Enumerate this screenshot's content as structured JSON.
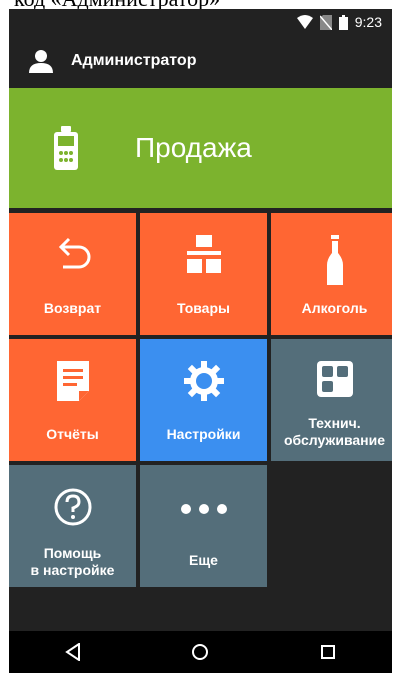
{
  "caption": "код «Администратор»",
  "status": {
    "time": "9:23",
    "icons": [
      "wifi-icon",
      "no-sim-icon",
      "battery-icon"
    ]
  },
  "user": {
    "name": "Администратор",
    "icon": "person-icon"
  },
  "sale": {
    "label": "Продажа",
    "icon": "pos-terminal-icon",
    "color": "#7cb32e"
  },
  "tiles": [
    {
      "label": "Возврат",
      "icon": "undo-arrow-icon",
      "color": "#ff6633"
    },
    {
      "label": "Товары",
      "icon": "boxes-icon",
      "color": "#ff6633"
    },
    {
      "label": "Алкоголь",
      "icon": "bottle-icon",
      "color": "#ff6633"
    },
    {
      "label": "Отчёты",
      "icon": "document-icon",
      "color": "#ff6633"
    },
    {
      "label": "Настройки",
      "icon": "gear-icon",
      "color": "#3b8ff0"
    },
    {
      "label": "Технич.\nобслуживание",
      "icon": "dashboard-icon",
      "color": "#546e7a"
    },
    {
      "label": "Помощь\nв настройке",
      "icon": "help-circle-icon",
      "color": "#546e7a"
    },
    {
      "label": "Еще",
      "icon": "more-dots-icon",
      "color": "#546e7a"
    }
  ],
  "nav": {
    "icons": [
      "back-triangle-icon",
      "home-circle-icon",
      "recents-square-icon"
    ]
  }
}
